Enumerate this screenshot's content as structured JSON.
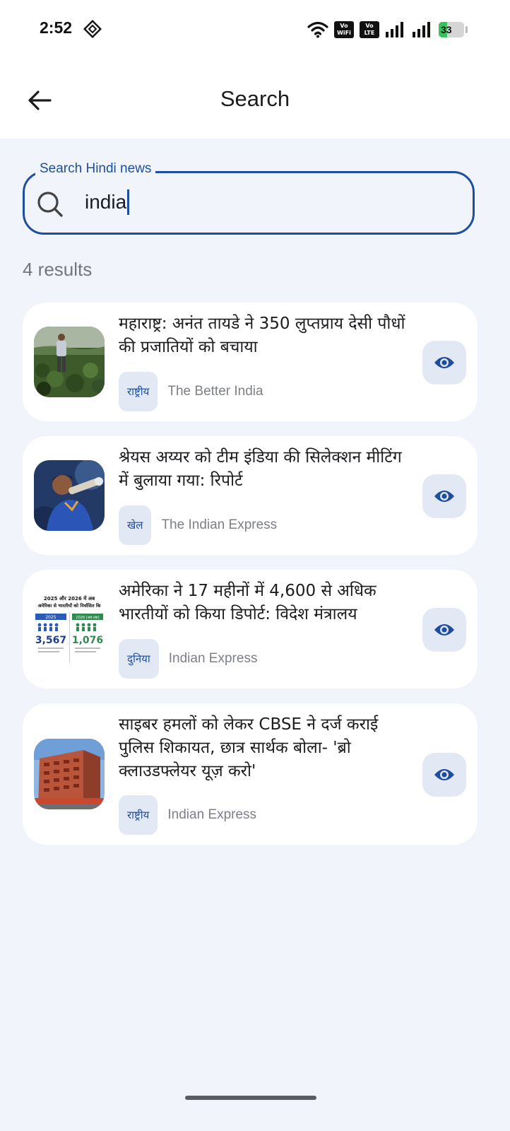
{
  "status_bar": {
    "time": "2:52",
    "sim1": {
      "top": "Vo",
      "bottom": "WiFi",
      "num": "1"
    },
    "sim2": {
      "top": "Vo",
      "bottom": "LTE",
      "num": "2"
    },
    "battery": "33",
    "battery_level": 0.33
  },
  "app_bar": {
    "title": "Search"
  },
  "search": {
    "label": "Search Hindi news",
    "value": "india"
  },
  "results_count": "4 results",
  "results": [
    {
      "title": "महाराष्ट्र: अनंत तायडे ने 350 लुप्तप्राय देसी पौधों की प्रजातियों को बचाया",
      "category": "राष्ट्रीय",
      "source": "The Better India",
      "thumb_icon": "farmer-photo"
    },
    {
      "title": "श्रेयस अय्यर को टीम इंडिया की सिलेक्शन मीटिंग में बुलाया गया: रिपोर्ट",
      "category": "खेल",
      "source": "The Indian Express",
      "thumb_icon": "cricketer-photo"
    },
    {
      "title": "अमेरिका ने 17 महीनों में 4,600 से अधिक भारतीयों को किया डिपोर्ट: विदेश मंत्रालय",
      "category": "दुनिया",
      "source": "Indian Express",
      "thumb_icon": "infographic",
      "thumb_text": {
        "heading1": "2025 और 2026 में अब",
        "heading2": "अमेरिका से भारतीयों को निर्वासित कि",
        "year_left": "2025",
        "year_right": "2026 (अब तक)",
        "value_left": "3,567",
        "value_right": "1,076"
      }
    },
    {
      "title": "साइबर हमलों को लेकर CBSE ने दर्ज कराई पुलिस शिकायत, छात्र सार्थक बोला- 'ब्रो क्लाउडफ्लेयर यूज़ करो'",
      "category": "राष्ट्रीय",
      "source": "Indian Express",
      "thumb_icon": "building-photo"
    }
  ],
  "colors": {
    "accent": "#1e4e9e",
    "background": "#f1f4fa",
    "card": "#ffffff",
    "chip": "#e2e8f4",
    "battery_green": "#36c45a"
  }
}
